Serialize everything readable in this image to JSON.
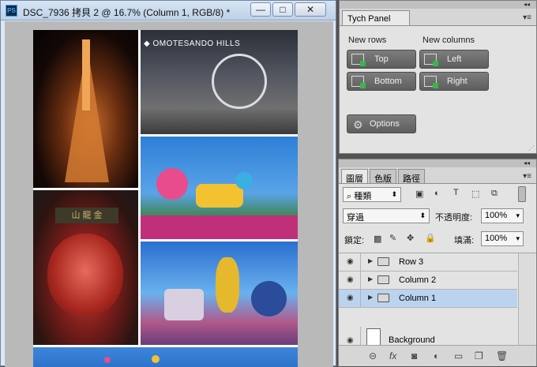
{
  "document": {
    "app_icon": "PS",
    "title": "DSC_7936 拷貝 2 @ 16.7% (Column 1, RGB/8) *",
    "min_label": "—",
    "max_label": "□",
    "close_label": "✕",
    "photo_overlays": {
      "omotesando_sign": "◆ OMOTESANDO HILLS",
      "temple_sign": "山 龍 金"
    }
  },
  "tych_panel": {
    "tab_label": "Tych Panel",
    "new_rows_label": "New rows",
    "new_columns_label": "New columns",
    "buttons": {
      "top": "Top",
      "bottom": "Bottom",
      "left": "Left",
      "right": "Right",
      "options": "Options"
    },
    "icons": {
      "collapse": "double-chevron-icon",
      "menu": "panel-menu-icon",
      "gear": "gear-icon"
    }
  },
  "layers_panel": {
    "tabs": [
      "圖層",
      "色版",
      "路徑"
    ],
    "filter": {
      "value": "種類"
    },
    "blend_mode": "穿過",
    "opacity_label": "不透明度:",
    "opacity_value": "100%",
    "lock_label": "鎖定:",
    "fill_label": "填滿:",
    "fill_value": "100%",
    "layers": [
      {
        "name": "Row 3",
        "visible": true,
        "selected": false
      },
      {
        "name": "Column 2",
        "visible": true,
        "selected": false
      },
      {
        "name": "Column 1",
        "visible": true,
        "selected": true
      }
    ],
    "background_layer": "Background",
    "footer_icons": [
      "link-icon",
      "fx-icon",
      "mask-icon",
      "adjustment-icon",
      "group-icon",
      "new-layer-icon",
      "trash-icon"
    ]
  }
}
